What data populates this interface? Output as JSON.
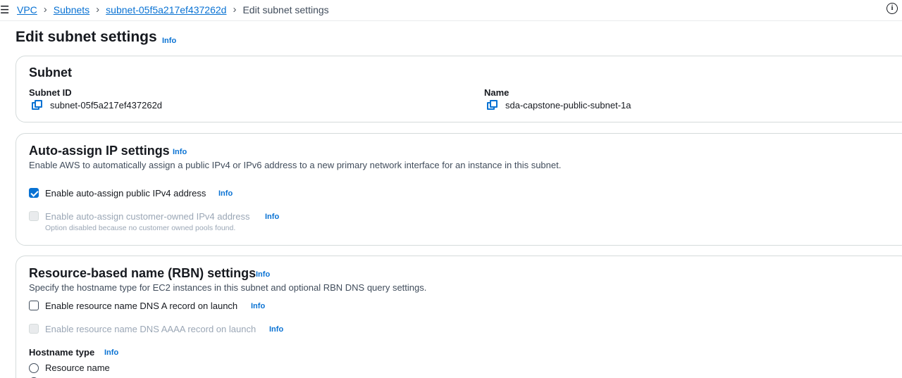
{
  "topbar": {
    "menu_icon": "hamburger-icon",
    "breadcrumbs": [
      "VPC",
      "Subnets",
      "subnet-05f5a217ef437262d",
      "Edit subnet settings"
    ],
    "help_icon": "info-circle-icon",
    "help_glyph": "i"
  },
  "page": {
    "title": "Edit subnet settings",
    "info": "Info"
  },
  "subnet": {
    "heading": "Subnet",
    "id_label": "Subnet ID",
    "id_value": "subnet-05f5a217ef437262d",
    "name_label": "Name",
    "name_value": "sda-capstone-public-subnet-1a"
  },
  "auto_assign": {
    "heading": "Auto-assign IP settings",
    "info": "Info",
    "description": "Enable AWS to automatically assign a public IPv4 or IPv6 address to a new primary network interface for an instance in this subnet.",
    "ipv4_label": "Enable auto-assign public IPv4 address",
    "ipv4_checked": true,
    "ipv4_info": "Info",
    "coip_label": "Enable auto-assign customer-owned IPv4 address",
    "coip_info": "Info",
    "coip_note": "Option disabled because no customer owned pools found."
  },
  "rbn": {
    "heading": "Resource-based name (RBN) settings",
    "info": "Info",
    "description": "Specify the hostname type for EC2 instances in this subnet and optional RBN DNS query settings.",
    "dns_a_label": "Enable resource name DNS A record on launch",
    "dns_a_info": "Info",
    "dns_aaaa_label": "Enable resource name DNS AAAA record on launch",
    "dns_aaaa_info": "Info",
    "hostname_label": "Hostname type",
    "hostname_info": "Info",
    "hostname_option_1": "Resource name"
  },
  "colors": {
    "accent": "#0972d3",
    "text": "#16191f",
    "muted": "#414d5c",
    "disabled": "#9ba7b6"
  }
}
